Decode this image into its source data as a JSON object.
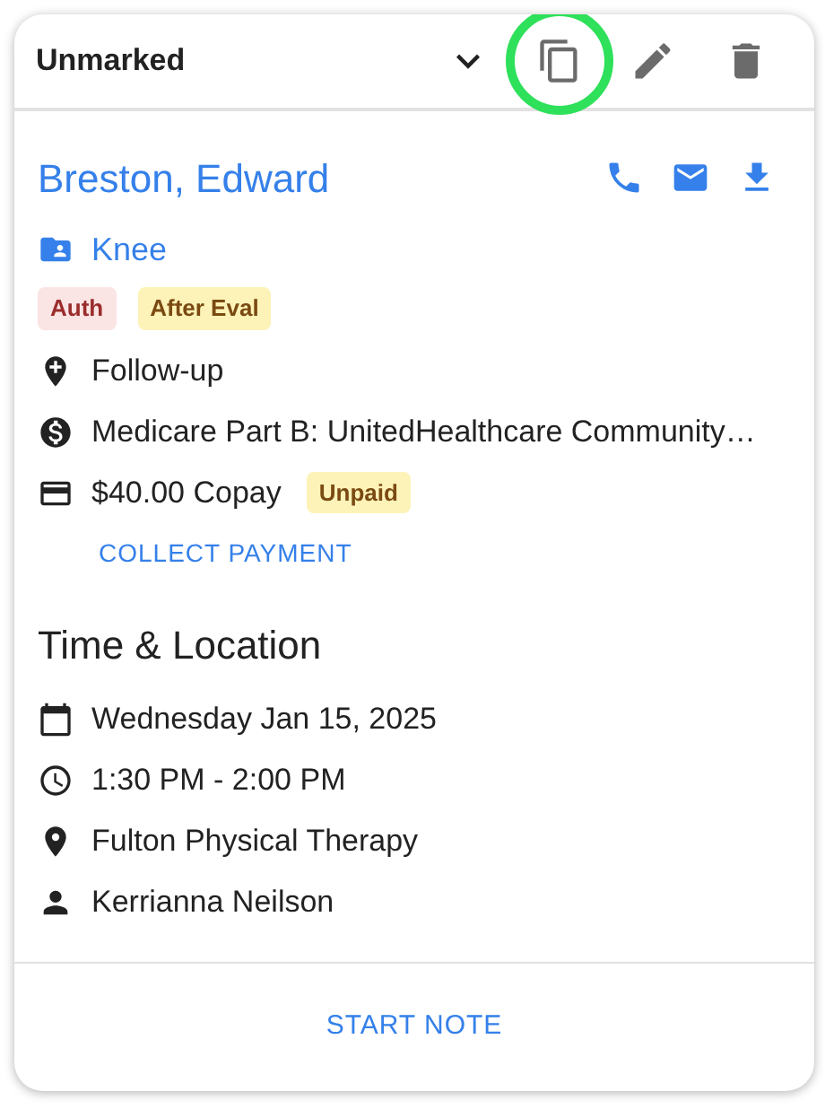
{
  "header": {
    "status": "Unmarked",
    "actions": [
      {
        "kind": "copy",
        "highlighted": true
      },
      {
        "kind": "edit",
        "highlighted": false
      },
      {
        "kind": "delete",
        "highlighted": false
      }
    ]
  },
  "patient": {
    "name": "Breston, Edward",
    "actions": [
      {
        "kind": "phone"
      },
      {
        "kind": "email"
      },
      {
        "kind": "download"
      }
    ]
  },
  "case": "Knee",
  "tags": [
    {
      "label": "Auth",
      "kind": "danger"
    },
    {
      "label": "After Eval",
      "kind": "warning"
    }
  ],
  "details": [
    {
      "kind": "visit",
      "text": "Follow-up"
    },
    {
      "kind": "insurance",
      "text": "Medicare Part B: UnitedHealthcare Community…"
    },
    {
      "kind": "payment",
      "text": "$40.00 Copay",
      "badge": "Unpaid"
    }
  ],
  "collect_button": "COLLECT PAYMENT",
  "section_title": "Time & Location",
  "time_location": [
    {
      "kind": "date",
      "text": "Wednesday Jan 15, 2025"
    },
    {
      "kind": "time",
      "text": "1:30 PM - 2:00 PM"
    },
    {
      "kind": "place",
      "text": "Fulton Physical Therapy"
    },
    {
      "kind": "person",
      "text": "Kerrianna Neilson"
    }
  ],
  "footer_button": "START NOTE"
}
